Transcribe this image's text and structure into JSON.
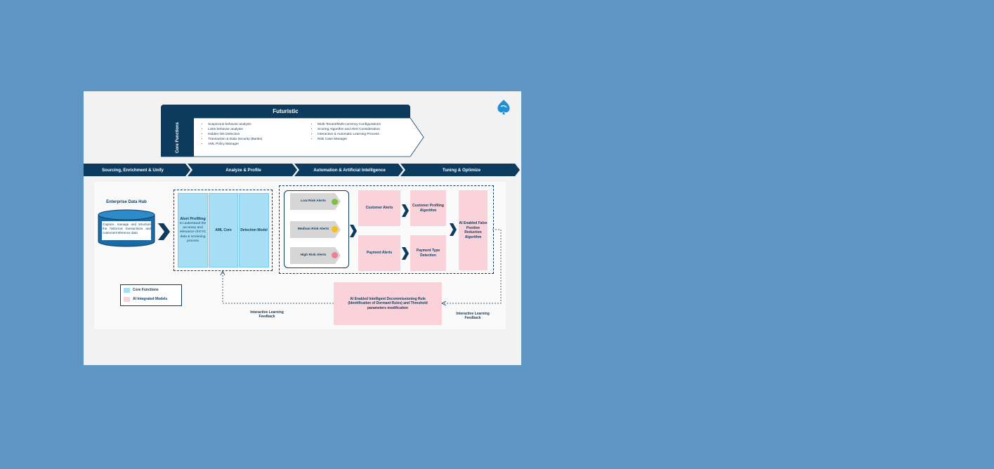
{
  "futuristic": {
    "title": "Futuristic",
    "side_label": "Core Functions",
    "left_items": [
      "Suspicious behavior analysis",
      "Links behavior analysis",
      "Hidden link Detection",
      "Transaction & Data Security (Banks)",
      "AML Policy Manager"
    ],
    "right_items": [
      "Multi-Tenant/Multi-currency Configurations",
      "Scoring Algorithm and Alert Consideration",
      "Interactive & Automatic Learning Process",
      "Risk Case Manager"
    ]
  },
  "stages": [
    "Sourcing, Enrichment & Unify",
    "Analyze & Profile",
    "Automation & Artificial Intelligence",
    "Tuning & Optimize"
  ],
  "hub": {
    "title": "Enterprise Data Hub",
    "description": "Capture, manage and structure the historical transactions and customer/reference data"
  },
  "core": {
    "alert_profiling_title": "Alert Profiling",
    "alert_profiling_desc": "to understand the accuracy and relevance of KYC data & screening process",
    "aml_core": "AML Core",
    "detection_model": "Detection Model"
  },
  "alerts": {
    "low": "Low Risk Alerts",
    "medium": "Medium Risk Alerts",
    "high": "High Risk Alerts"
  },
  "models": {
    "customer_alerts": "Customer Alerts",
    "customer_profiling": "Customer Profiling Algorithm",
    "payment_alerts": "Payment Alerts",
    "payment_type": "Payment Type Detection",
    "false_positive": "AI Enabled False Positive Reduction Algorithm",
    "decommissioning": "AI Enabled Intelligent Decommissioning Rule (Identification of Dormant Rules) and Threshold parameters modification"
  },
  "legend": {
    "core_functions": "Core Functions",
    "ai_models": "AI Integrated Models"
  },
  "feedback": {
    "left": "Interactive Learning Feedback",
    "right": "Interactive Learning Feedback"
  },
  "colors": {
    "navy": "#0d3b5e",
    "core_blue": "#a6dff5",
    "ai_pink": "#fad3da",
    "low": "#7fbf3f",
    "medium": "#f2c21b",
    "high": "#ee7f92"
  }
}
